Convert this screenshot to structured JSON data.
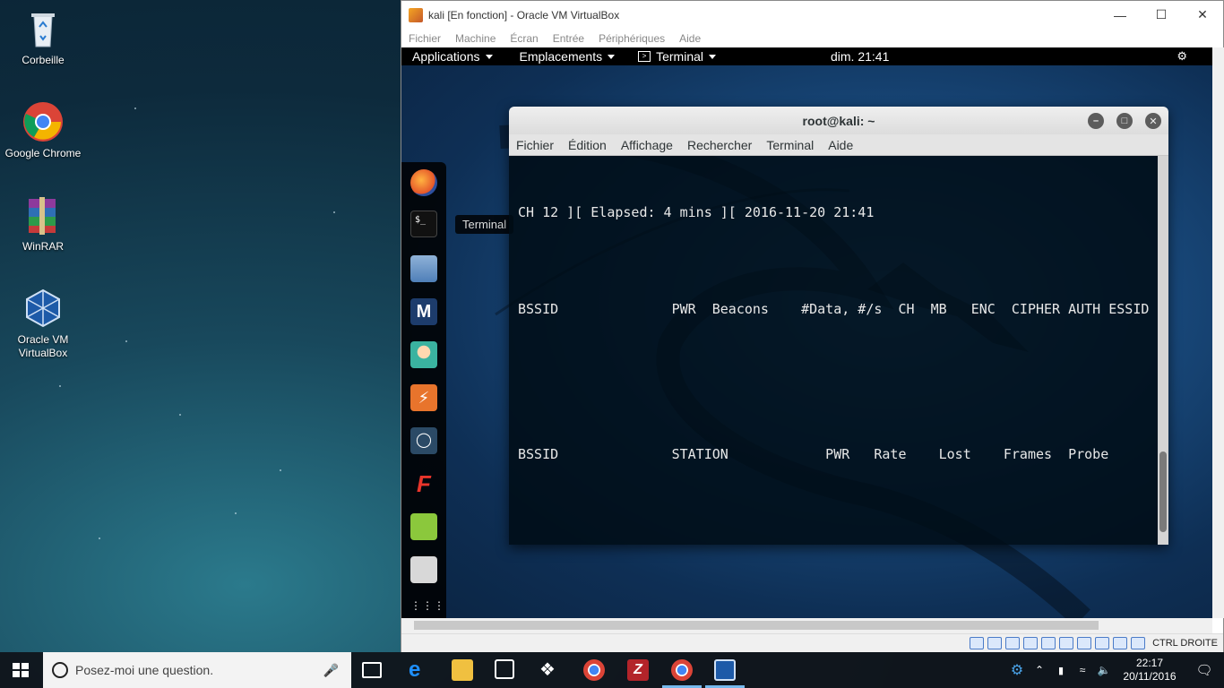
{
  "desktop": {
    "icons": [
      {
        "label": "Corbeille"
      },
      {
        "label": "Google Chrome"
      },
      {
        "label": "WinRAR"
      },
      {
        "label": "Oracle VM VirtualBox"
      }
    ]
  },
  "vbox": {
    "title": "kali [En fonction] - Oracle VM VirtualBox",
    "menu": [
      "Fichier",
      "Machine",
      "Écran",
      "Entrée",
      "Périphériques",
      "Aide"
    ],
    "host_key": "CTRL DROITE"
  },
  "kali": {
    "topbar": {
      "applications": "Applications",
      "places": "Emplacements",
      "app": "Terminal",
      "clock": "dim. 21:41"
    },
    "tooltip": "Terminal",
    "dock_items": [
      "firefox-icon",
      "terminal-icon",
      "files-icon",
      "metasploit-icon",
      "armitage-icon",
      "burpsuite-icon",
      "maltego-icon",
      "faraday-icon",
      "leafpad-icon",
      "settings-icon",
      "show-apps-icon"
    ]
  },
  "terminal": {
    "title": "root@kali: ~",
    "menu": [
      "Fichier",
      "Édition",
      "Affichage",
      "Rechercher",
      "Terminal",
      "Aide"
    ],
    "lines": [
      "CH 12 ][ Elapsed: 4 mins ][ 2016-11-20 21:41",
      "",
      "BSSID              PWR  Beacons    #Data, #/s  CH  MB   ENC  CIPHER AUTH ESSID",
      "",
      "",
      "BSSID              STATION            PWR   Rate    Lost    Frames  Probe"
    ]
  },
  "taskbar": {
    "search_placeholder": "Posez-moi une question.",
    "time": "22:17",
    "date": "20/11/2016"
  },
  "colors": {
    "vbox_accent": "#4a7bc8",
    "taskbar_active": "#76b9ed"
  }
}
